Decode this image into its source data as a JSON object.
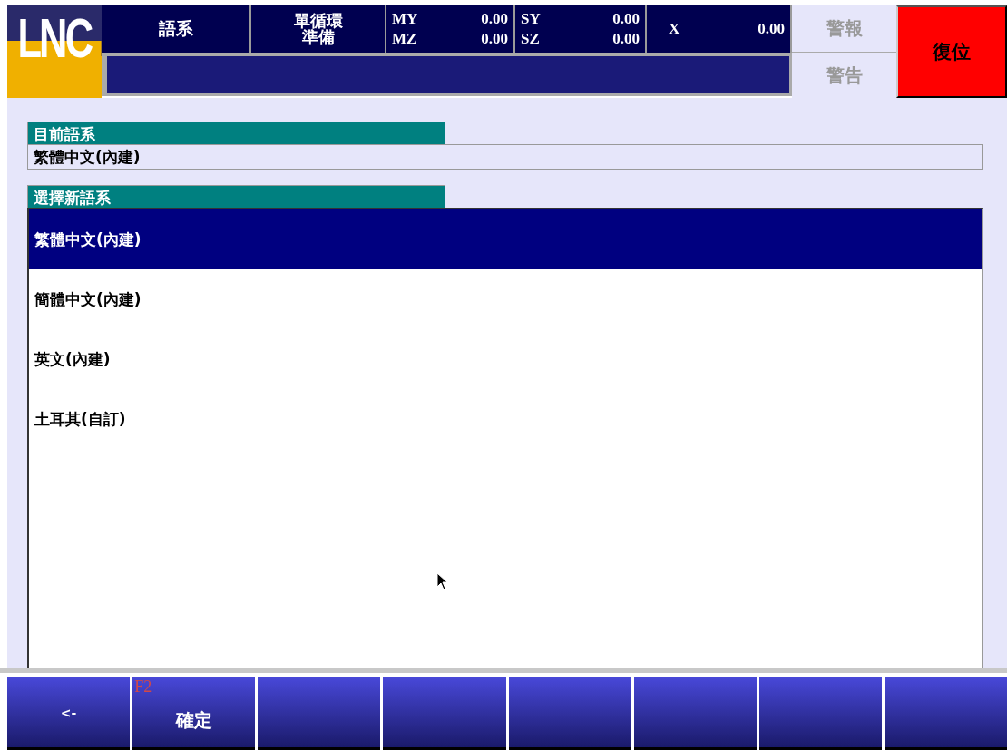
{
  "header": {
    "logo": "LNC",
    "mode": "語系",
    "status_lines": [
      "單循環",
      "準備"
    ],
    "axis_columns": [
      [
        {
          "axis": "MY",
          "value": "0.00"
        },
        {
          "axis": "MZ",
          "value": "0.00"
        }
      ],
      [
        {
          "axis": "SY",
          "value": "0.00"
        },
        {
          "axis": "SZ",
          "value": "0.00"
        }
      ],
      [
        {
          "axis": "X",
          "value": "0.00"
        }
      ]
    ],
    "alarm": "警報",
    "warning": "警告",
    "reset": "復位"
  },
  "current_language": {
    "title": "目前語系",
    "value": "繁體中文(內建)"
  },
  "language_list": {
    "title": "選擇新語系",
    "items": [
      {
        "label": "繁體中文(內建)",
        "selected": true
      },
      {
        "label": "簡體中文(內建)",
        "selected": false
      },
      {
        "label": "英文(內建)",
        "selected": false
      },
      {
        "label": "土耳其(自訂)",
        "selected": false
      }
    ]
  },
  "softkeys": [
    {
      "kind": "action",
      "label": "<-"
    },
    {
      "kind": "action",
      "label": "確定",
      "fkey": "F2"
    },
    {
      "kind": "blank"
    },
    {
      "kind": "blank"
    },
    {
      "kind": "blank"
    },
    {
      "kind": "blank"
    },
    {
      "kind": "blank"
    },
    {
      "kind": "blank"
    }
  ]
}
